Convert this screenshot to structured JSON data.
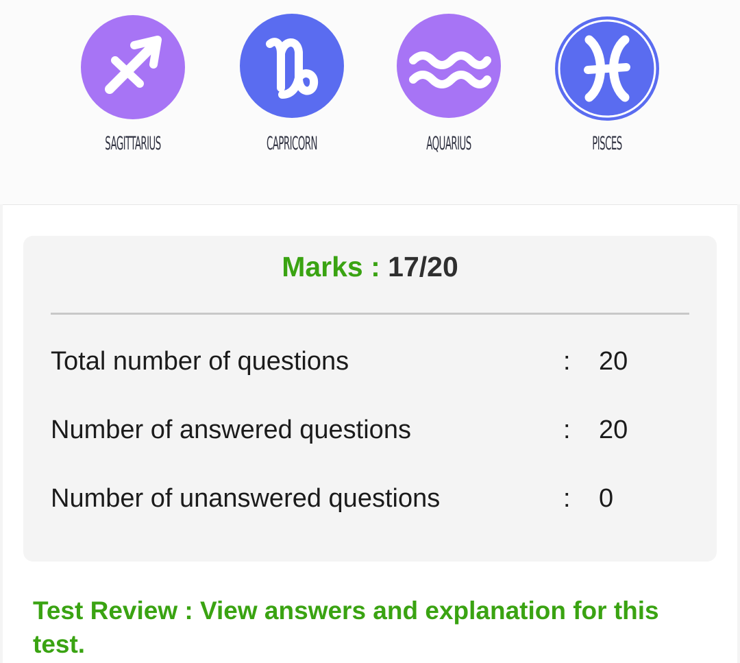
{
  "zodiac": {
    "signs": [
      {
        "label": "SAGITTARIUS",
        "icon": "sagittarius-icon",
        "color": "#a774f5"
      },
      {
        "label": "CAPRICORN",
        "icon": "capricorn-icon",
        "color": "#5a6cf0"
      },
      {
        "label": "AQUARIUS",
        "icon": "aquarius-icon",
        "color": "#a774f5"
      },
      {
        "label": "PISCES",
        "icon": "pisces-icon",
        "color": "#5a6cf0"
      }
    ]
  },
  "result": {
    "marks_label": "Marks :",
    "marks_value": "17/20",
    "stats": [
      {
        "label": "Total number of questions",
        "colon": ":",
        "value": "20"
      },
      {
        "label": "Number of answered questions",
        "colon": ":",
        "value": "20"
      },
      {
        "label": "Number of unanswered questions",
        "colon": ":",
        "value": "0"
      }
    ],
    "review_text": "Test Review : View answers and explanation for this test."
  },
  "colors": {
    "accent_green": "#3aa312",
    "purple": "#a774f5",
    "blue": "#5a6cf0"
  }
}
